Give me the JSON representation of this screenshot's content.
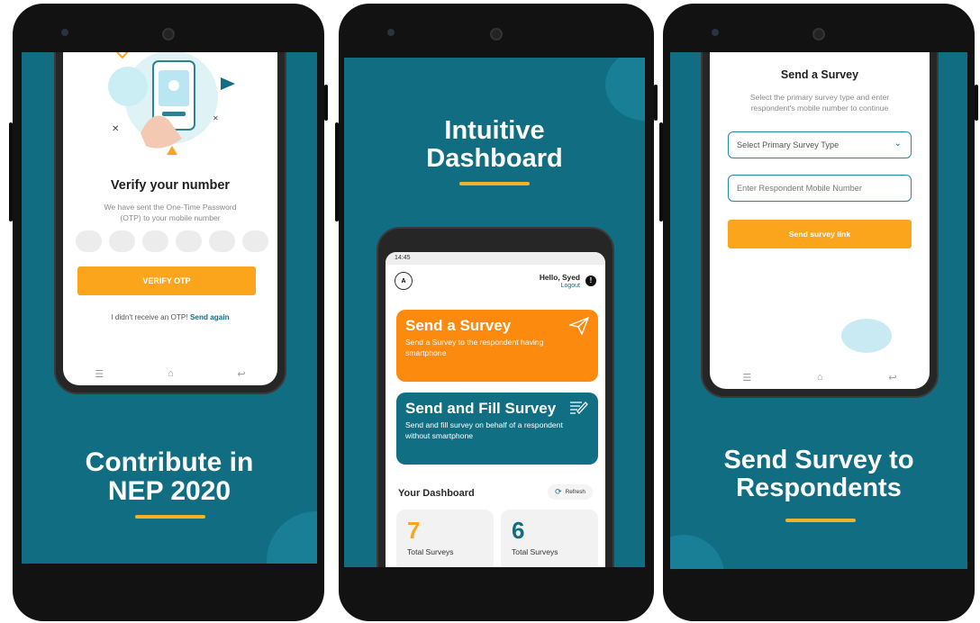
{
  "panel1": {
    "title_line1": "Contribute in",
    "title_line2": "NEP 2020",
    "screen": {
      "heading": "Verify your number",
      "desc_line1": "We have sent the One-Time Password",
      "desc_line2": "(OTP) to your mobile number",
      "otp_count": 6,
      "button": "VERIFY OTP",
      "resend_text": "I didn't receive an OTP!",
      "resend_link": "Send again"
    }
  },
  "panel2": {
    "title_line1": "Intuitive",
    "title_line2": "Dashboard",
    "screen": {
      "status_time": "14:45",
      "greeting": "Hello, Syed",
      "logout": "Logout",
      "avatar_initials": "A",
      "card1_title": "Send a Survey",
      "card1_desc": "Send a Survey to the respondent having smartphone",
      "card2_title": "Send and Fill Survey",
      "card2_desc": "Send and fill survey on behalf of a respondent without smartphone",
      "dashboard_title": "Your Dashboard",
      "refresh": "Refresh",
      "stats": [
        {
          "value": "7",
          "label": "Total Surveys",
          "color": "#fba51c"
        },
        {
          "value": "6",
          "label": "Total Surveys",
          "color": "#106d82"
        }
      ]
    }
  },
  "panel3": {
    "title_line1": "Send Survey to",
    "title_line2": "Respondents",
    "screen": {
      "heading": "Send a Survey",
      "desc_line1": "Select the primary survey type and enter",
      "desc_line2": "respondent's mobile number to continue",
      "select_value": "Select Primary Survey Type",
      "mobile_placeholder": "Enter Respondent Mobile Number",
      "button": "Send survey link"
    }
  },
  "colors": {
    "teal": "#106d82",
    "orange": "#fba51c",
    "accent_line": "#f2b12a"
  },
  "icons": {
    "nav_menu": "menu-icon",
    "nav_home": "home-icon",
    "nav_back": "back-icon",
    "send": "paper-plane-icon",
    "fill": "edit-icon",
    "refresh": "refresh-icon",
    "chevron": "chevron-down-icon"
  }
}
